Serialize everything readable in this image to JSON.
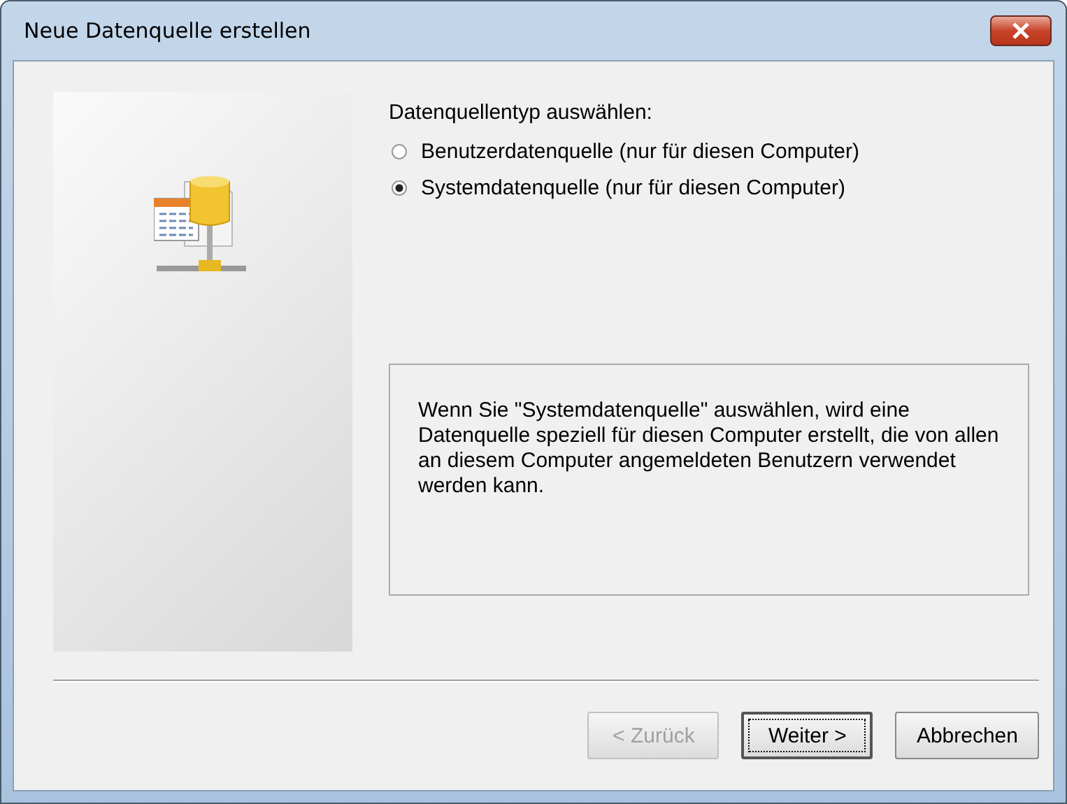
{
  "window": {
    "title": "Neue Datenquelle erstellen"
  },
  "group_label": "Datenquellentyp auswählen:",
  "options": [
    {
      "label": "Benutzerdatenquelle (nur für diesen Computer)",
      "selected": false
    },
    {
      "label": "Systemdatenquelle (nur für diesen Computer)",
      "selected": true
    }
  ],
  "description": "Wenn Sie \"Systemdatenquelle\" auswählen, wird eine Datenquelle speziell für diesen Computer erstellt, die von allen an diesem Computer angemeldeten Benutzern verwendet werden kann.",
  "buttons": [
    {
      "label": "< Zurück",
      "disabled": true,
      "default": false
    },
    {
      "label": "Weiter >",
      "disabled": false,
      "default": true
    },
    {
      "label": "Abbrechen",
      "disabled": false,
      "default": false
    }
  ]
}
